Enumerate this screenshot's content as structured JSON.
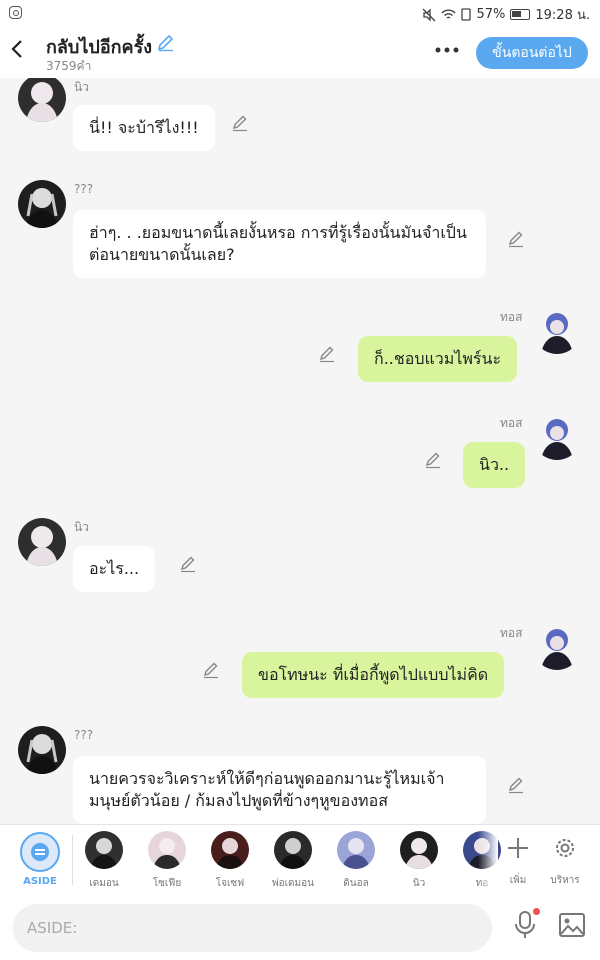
{
  "status_bar": {
    "battery": "57%",
    "time": "19:28 น."
  },
  "header": {
    "back_icon": "chevron-left-icon",
    "title": "กลับไปอีกครั้ง",
    "word_count": "3759คำ",
    "more_icon": "more-dots-icon",
    "next_button": "ขั้นตอนต่อไป"
  },
  "messages": [
    {
      "side": "left",
      "name": "นิว",
      "text": "นี่!! จะบ้ารึไง!!!",
      "avatar_color": "#dad3d6"
    },
    {
      "side": "left",
      "name": "???",
      "text": "ฮ่าๆ. . .ยอมขนาดนี้เลยงั้นหรอ การที่รู้เรื่องนั้นมันจำเป็นต่อนายขนาดนั้นเลย?",
      "avatar_color": "#2b2b2b"
    },
    {
      "side": "right",
      "name": "ทอส",
      "text": "ก็..ชอบแวมไพร์นะ",
      "avatar_color": "#3b4a8c"
    },
    {
      "side": "right",
      "name": "ทอส",
      "text": "นิว..",
      "avatar_color": "#3b4a8c"
    },
    {
      "side": "left",
      "name": "นิว",
      "text": "อะไร...",
      "avatar_color": "#dad3d6"
    },
    {
      "side": "right",
      "name": "ทอส",
      "text": "ขอโทษนะ ที่เมื่อกี้พูดไปแบบไม่คิด",
      "avatar_color": "#3b4a8c"
    },
    {
      "side": "left",
      "name": "???",
      "text": "นายควรจะวิเคราะห์ให้ดีๆก่อนพูดออกมานะรู้ไหมเจ้ามนุษย์ตัวน้อย / ก้มลงไปพูดที่ข้างๆหูของทอส",
      "avatar_color": "#2b2b2b"
    }
  ],
  "character_bar": {
    "aside_label": "ASIDE",
    "characters": [
      {
        "label": "เดมอน",
        "color": "#303030"
      },
      {
        "label": "โซเฟีย",
        "color": "#e6d6dc"
      },
      {
        "label": "โจเซฟ",
        "color": "#4a1d1d"
      },
      {
        "label": "พ่อเดมอน",
        "color": "#2a2a2a"
      },
      {
        "label": "ดินอล",
        "color": "#9aa4d6"
      },
      {
        "label": "นิว",
        "color": "#1f1f1f"
      },
      {
        "label": "ทอ",
        "color": "#3b4a8c"
      }
    ],
    "add_label": "เพิ่ม",
    "manage_label": "บริหาร"
  },
  "input_bar": {
    "placeholder": "ASIDE:"
  },
  "colors": {
    "accent": "#5aa8ef",
    "right_bubble": "#d8f59e",
    "left_bubble": "#ffffff"
  }
}
